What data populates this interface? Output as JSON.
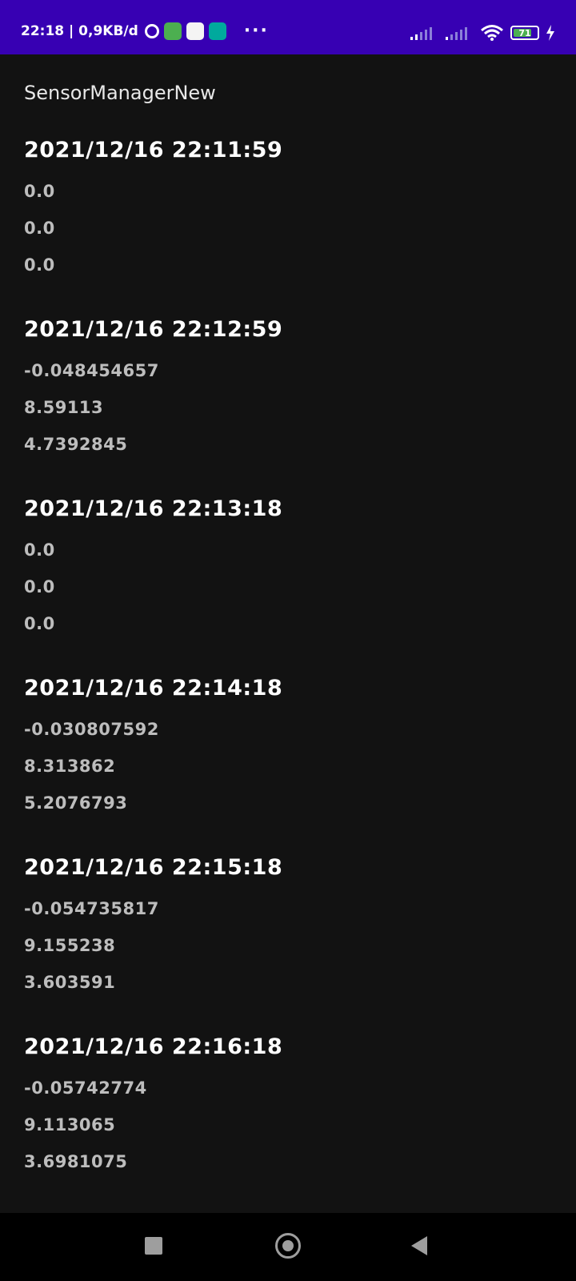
{
  "status_bar": {
    "time_speed": "22:18 | 0,9KB/d",
    "battery": "71",
    "more": "···",
    "colors": {
      "background": "#3700b3",
      "app1": "#4caf50",
      "app2": "#f4f4f4",
      "app3": "#00a99d"
    }
  },
  "app": {
    "title": "SensorManagerNew"
  },
  "readings": [
    {
      "timestamp": "2021/12/16  22:11:59",
      "x": "0.0",
      "y": "0.0",
      "z": "0.0"
    },
    {
      "timestamp": "2021/12/16  22:12:59",
      "x": "-0.048454657",
      "y": "8.59113",
      "z": "4.7392845"
    },
    {
      "timestamp": "2021/12/16  22:13:18",
      "x": "0.0",
      "y": "0.0",
      "z": "0.0"
    },
    {
      "timestamp": "2021/12/16  22:14:18",
      "x": "-0.030807592",
      "y": "8.313862",
      "z": "5.2076793"
    },
    {
      "timestamp": "2021/12/16  22:15:18",
      "x": "-0.054735817",
      "y": "9.155238",
      "z": "3.603591"
    },
    {
      "timestamp": "2021/12/16  22:16:18",
      "x": "-0.05742774",
      "y": "9.113065",
      "z": "3.6981075"
    }
  ],
  "nav_bar": {
    "icons": [
      "recents-icon",
      "home-icon",
      "back-icon"
    ]
  }
}
